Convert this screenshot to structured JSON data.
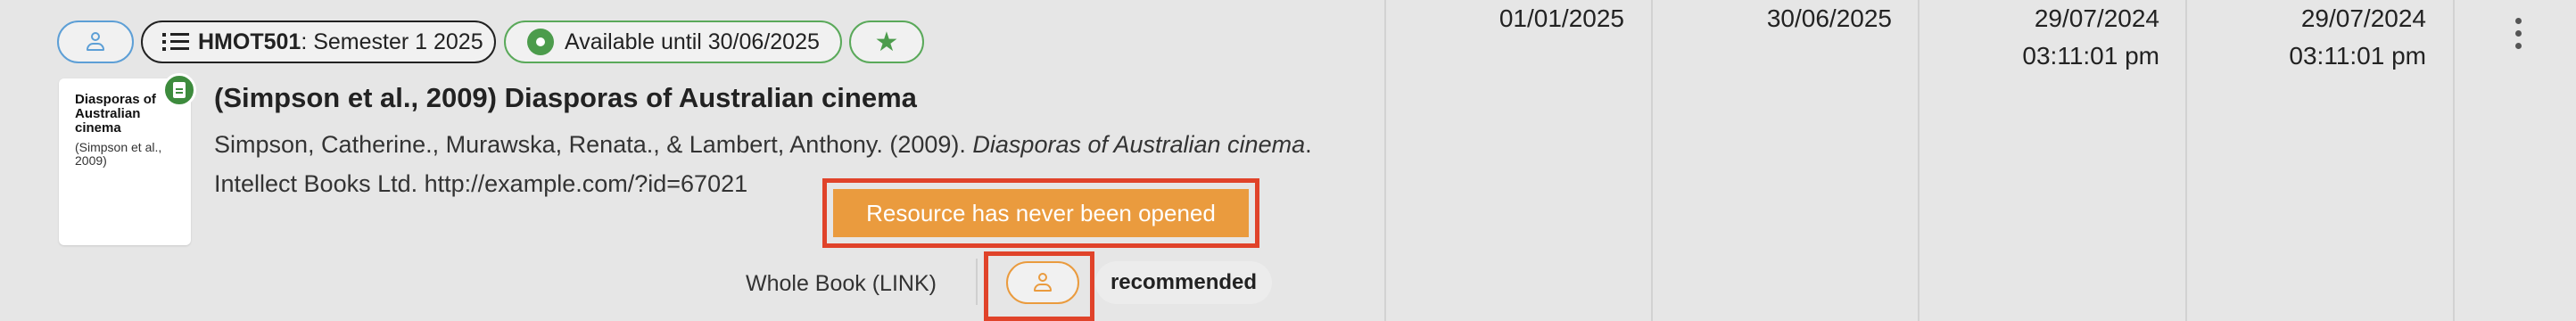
{
  "chips": {
    "course_code": "HMOT501",
    "course_term": ": Semester 1 2025",
    "availability": "Available until 30/06/2025",
    "star_icon": "star-icon",
    "user_icon": "person-icon",
    "list_icon": "list-icon"
  },
  "thumbnail": {
    "title": "Diasporas of Australian cinema",
    "subtitle": "(Simpson et al., 2009)",
    "badge_icon": "document-icon"
  },
  "resource": {
    "title": "(Simpson et al., 2009) Diasporas of Australian cinema",
    "citation_authors": "Simpson, Catherine., Murawska, Renata., & Lambert, Anthony. (2009). ",
    "citation_work": "Diasporas of Australian cinema",
    "citation_rest": ". Intellect Books Ltd. http://example.com/?id=67021"
  },
  "tooltip": "Resource has never been opened",
  "footer": {
    "scope": "Whole Book  (LINK)",
    "tag": "recommended"
  },
  "columns": {
    "date_1": "01/01/2025",
    "date_2": "30/06/2025",
    "date_3": "29/07/2024",
    "time_3": "03:11:01 pm",
    "date_4": "29/07/2024",
    "time_4": "03:11:01 pm"
  },
  "colors": {
    "blue": "#5d9fd6",
    "green": "#4c9c4c",
    "orange": "#ea9b3e",
    "highlight": "#e0432a"
  }
}
